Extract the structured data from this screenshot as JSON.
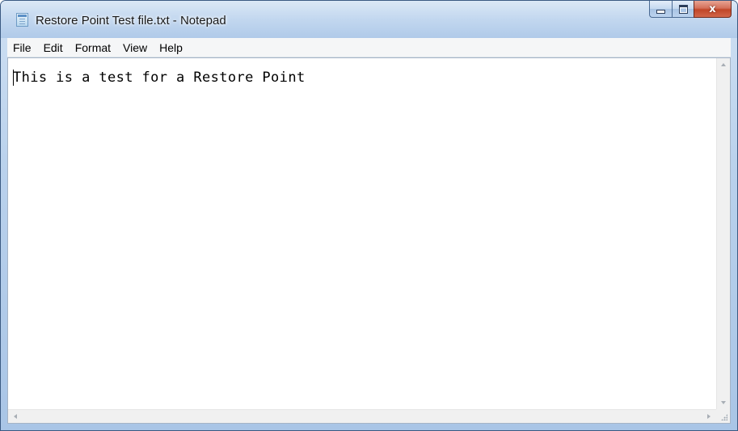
{
  "window": {
    "title": "Restore Point Test file.txt - Notepad",
    "icon": "notepad-icon"
  },
  "caption_buttons": {
    "minimize_icon": "minimize-icon",
    "maximize_icon": "maximize-icon",
    "close_icon": "close-icon",
    "close_glyph": "x",
    "close_color": "#c8452a"
  },
  "menubar": {
    "items": [
      {
        "label": "File"
      },
      {
        "label": "Edit"
      },
      {
        "label": "Format"
      },
      {
        "label": "View"
      },
      {
        "label": "Help"
      }
    ]
  },
  "document": {
    "text": "This is a test for a Restore Point"
  },
  "scrollbars": {
    "up_icon": "scroll-up-arrow-icon",
    "down_icon": "scroll-down-arrow-icon",
    "left_icon": "scroll-left-arrow-icon",
    "right_icon": "scroll-right-arrow-icon",
    "grip_icon": "resize-grip-icon"
  },
  "colors": {
    "frame": "#b9d1ec",
    "menubar": "#f5f6f7",
    "editor_bg": "#ffffff"
  }
}
